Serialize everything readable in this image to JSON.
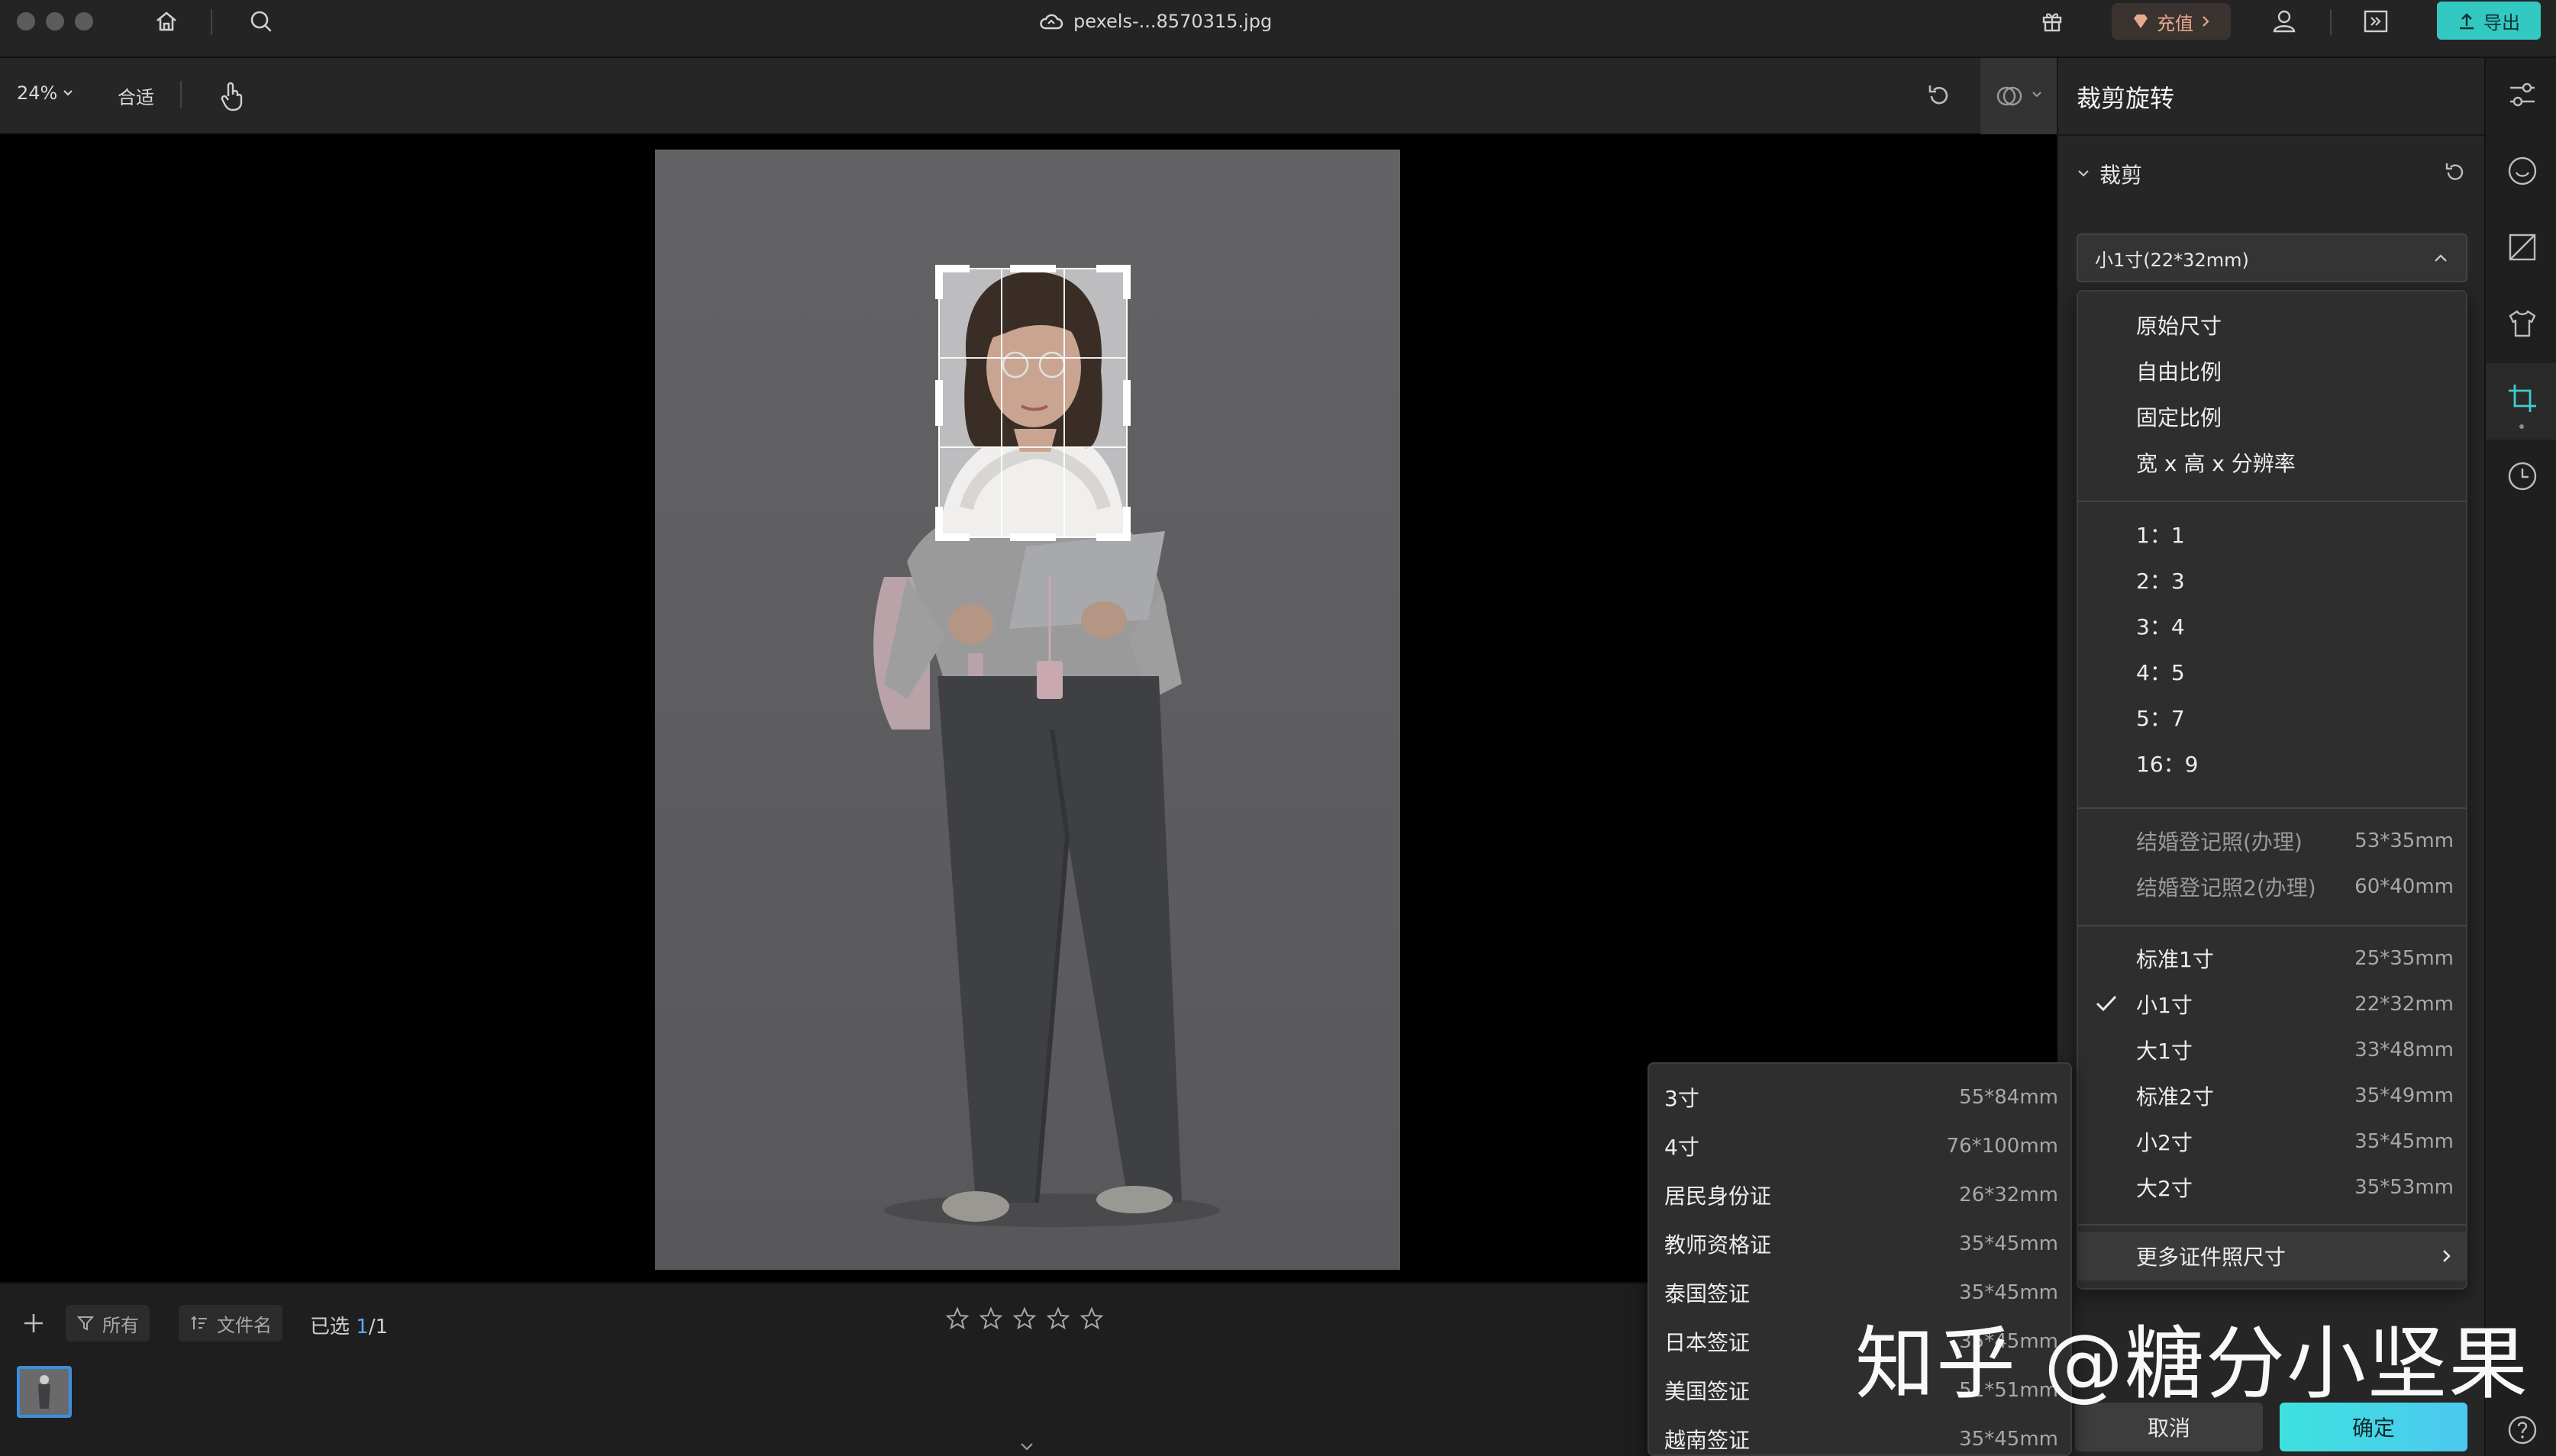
{
  "titlebar": {
    "file_name": "pexels-...8570315.jpg",
    "recharge_label": "充值",
    "export_label": "导出"
  },
  "toolbar": {
    "zoom": "24%",
    "fit_label": "合适"
  },
  "panel": {
    "title": "裁剪旋转",
    "section_label": "裁剪",
    "selected_option": "小1寸(22*32mm)",
    "options": [
      {
        "label": "原始尺寸",
        "size": ""
      },
      {
        "label": "自由比例",
        "size": ""
      },
      {
        "label": "固定比例",
        "size": ""
      },
      {
        "label": "宽 x 高 x 分辨率",
        "size": ""
      },
      {
        "label": "1：1",
        "size": ""
      },
      {
        "label": "2：3",
        "size": ""
      },
      {
        "label": "3：4",
        "size": ""
      },
      {
        "label": "4：5",
        "size": ""
      },
      {
        "label": "5：7",
        "size": ""
      },
      {
        "label": "16：9",
        "size": ""
      },
      {
        "label": "结婚登记照(办理)",
        "size": "53*35mm"
      },
      {
        "label": "结婚登记照2(办理)",
        "size": "60*40mm"
      },
      {
        "label": "标准1寸",
        "size": "25*35mm"
      },
      {
        "label": "小1寸",
        "size": "22*32mm"
      },
      {
        "label": "大1寸",
        "size": "33*48mm"
      },
      {
        "label": "标准2寸",
        "size": "35*49mm"
      },
      {
        "label": "小2寸",
        "size": "35*45mm"
      },
      {
        "label": "大2寸",
        "size": "35*53mm"
      }
    ],
    "more_label": "更多证件照尺寸",
    "cancel_label": "取消",
    "confirm_label": "确定"
  },
  "submenu": {
    "items": [
      {
        "label": "3寸",
        "size": "55*84mm"
      },
      {
        "label": "4寸",
        "size": "76*100mm"
      },
      {
        "label": "居民身份证",
        "size": "26*32mm"
      },
      {
        "label": "教师资格证",
        "size": "35*45mm"
      },
      {
        "label": "泰国签证",
        "size": "35*45mm"
      },
      {
        "label": "日本签证",
        "size": "35*45mm"
      },
      {
        "label": "美国签证",
        "size": "51*51mm"
      },
      {
        "label": "越南签证",
        "size": "35*45mm"
      }
    ]
  },
  "bottombar": {
    "filter_label": "所有",
    "sort_label": "文件名",
    "selected_label": "已选",
    "selected_count": "1",
    "selected_total": "/1",
    "rating": 0
  },
  "watermark": "知乎 @糖分小坚果",
  "colors": {
    "accent": "#33c8c2",
    "selection_blue": "#3c8fe0",
    "panel_bg": "#262626"
  }
}
